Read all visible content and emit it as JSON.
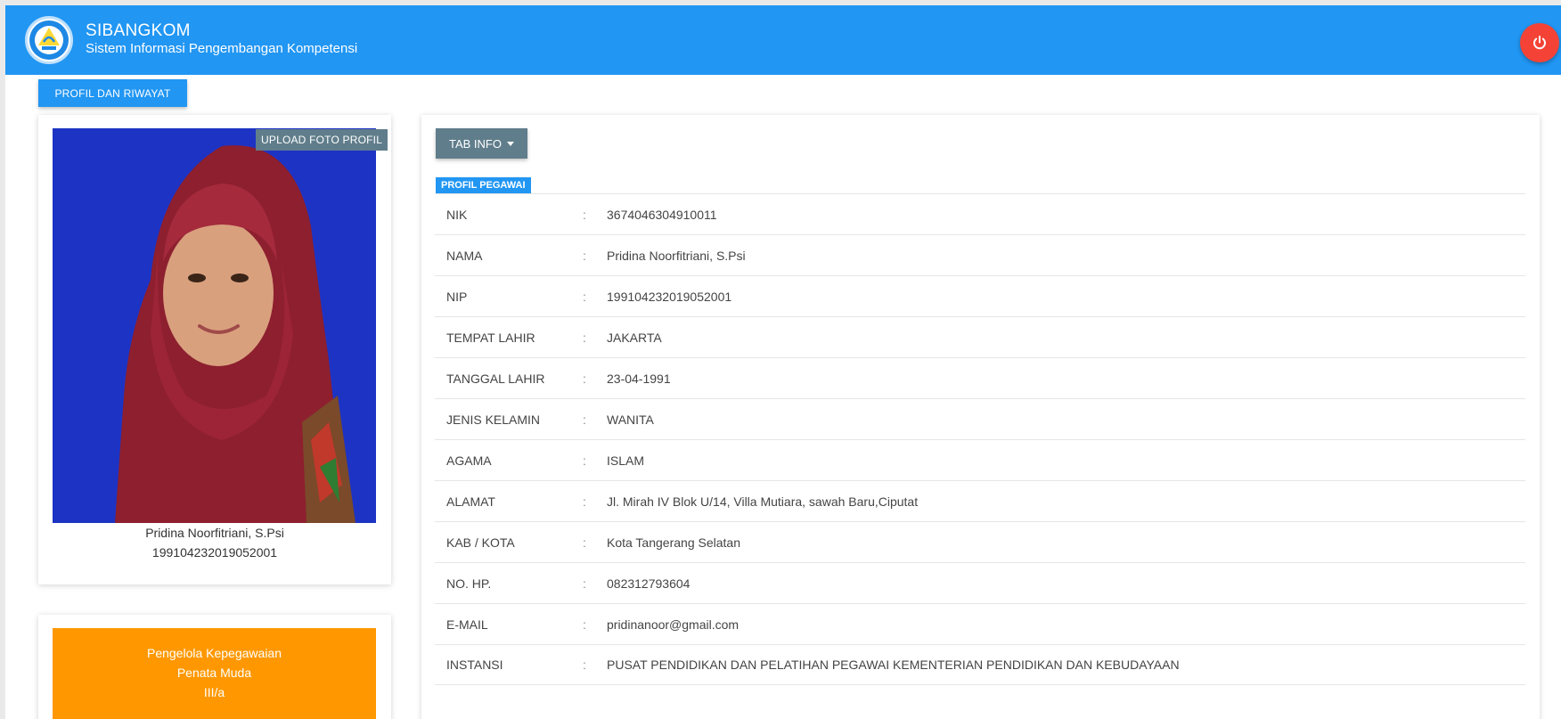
{
  "app": {
    "title": "SIBANGKOM",
    "subtitle": "Sistem Informasi Pengembangan Kompetensi",
    "brand_color": "#2196f3"
  },
  "nav": {
    "profil_button": "PROFIL DAN RIWAYAT"
  },
  "profile_card": {
    "upload_label": "UPLOAD FOTO PROFIL",
    "name": "Pridina Noorfitriani, S.Psi",
    "nip": "199104232019052001"
  },
  "jabatan": {
    "line1": "Pengelola Kepegawaian",
    "line2": "Penata Muda",
    "line3": "III/a",
    "color": "#ff9800"
  },
  "main": {
    "tab_button": "TAB INFO",
    "section_label": "PROFIL PEGAWAI",
    "rows": [
      {
        "label": "NIK",
        "value": "3674046304910011"
      },
      {
        "label": "NAMA",
        "value": "Pridina Noorfitriani, S.Psi"
      },
      {
        "label": "NIP",
        "value": "199104232019052001"
      },
      {
        "label": "TEMPAT LAHIR",
        "value": "JAKARTA"
      },
      {
        "label": "TANGGAL LAHIR",
        "value": "23-04-1991"
      },
      {
        "label": "JENIS KELAMIN",
        "value": "WANITA"
      },
      {
        "label": "AGAMA",
        "value": "ISLAM"
      },
      {
        "label": "ALAMAT",
        "value": "Jl. Mirah IV Blok U/14, Villa Mutiara, sawah Baru,Ciputat"
      },
      {
        "label": "KAB / KOTA",
        "value": "Kota Tangerang Selatan"
      },
      {
        "label": "NO. HP.",
        "value": "082312793604"
      },
      {
        "label": "E-MAIL",
        "value": "pridinanoor@gmail.com"
      },
      {
        "label": "INSTANSI",
        "value": "PUSAT PENDIDIKAN DAN PELATIHAN PEGAWAI KEMENTERIAN PENDIDIKAN DAN KEBUDAYAAN"
      }
    ]
  },
  "icons": {
    "logo": "tut-wuri-handayani-logo",
    "power": "power-icon"
  }
}
